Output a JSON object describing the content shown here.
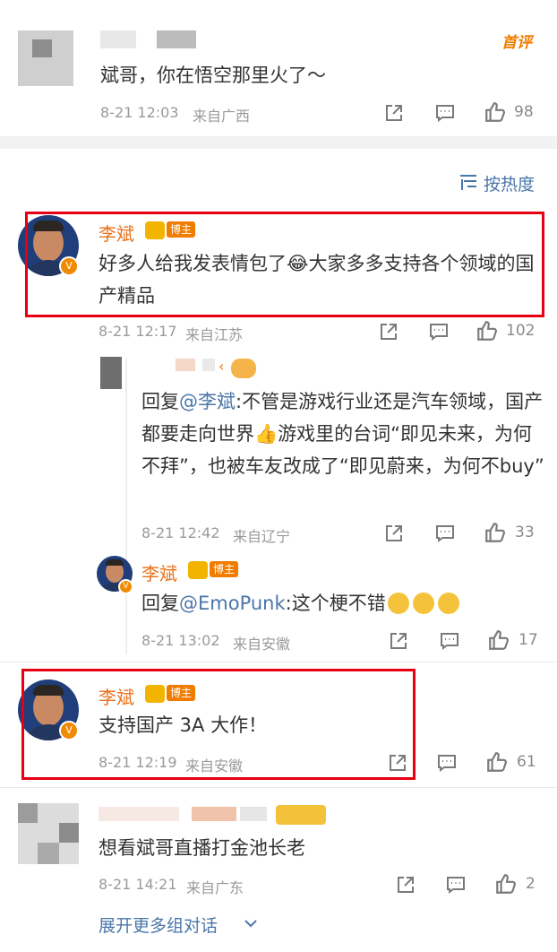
{
  "top_comment": {
    "text": "斌哥，你在悟空那里火了～",
    "time": "8-21 12:03",
    "location": "来自广西",
    "likes": "98",
    "first_badge": "首评"
  },
  "sort": {
    "label": "按热度"
  },
  "comment1": {
    "author": "李斌",
    "badge": "博主",
    "text": "好多人给我发表情包了😂大家多多支持各个领域的国产精品",
    "time": "8-21 12:17",
    "location": "来自江苏",
    "likes": "102"
  },
  "reply1": {
    "prefix": "回复",
    "mention": "@李斌",
    "text": ":不管是游戏行业还是汽车领域，国产都要走向世界👍游戏里的台词“即见未来，为何不拜”，也被车友改成了“即见蔚来，为何不buy”",
    "time": "8-21 12:42",
    "location": "来自辽宁",
    "likes": "33"
  },
  "reply2": {
    "author": "李斌",
    "badge": "博主",
    "prefix": "回复",
    "mention": "@EmoPunk",
    "text": ":这个梗不错",
    "time": "8-21 13:02",
    "location": "来自安徽",
    "likes": "17"
  },
  "comment2": {
    "author": "李斌",
    "badge": "博主",
    "text": "支持国产 3A 大作！",
    "time": "8-21 12:19",
    "location": "来自安徽",
    "likes": "61"
  },
  "comment3": {
    "text": "想看斌哥直播打金池长老",
    "time": "8-21 14:21",
    "location": "来自广东",
    "likes": "2"
  },
  "expand": {
    "label": "展开更多组对话"
  },
  "colors": {
    "name": "#e8711a",
    "link": "#4a76a8",
    "highlight": "#e60012"
  },
  "icons": [
    "share-icon",
    "comment-icon",
    "like-icon",
    "sort-icon",
    "chevron-down-icon",
    "crown-badge-icon"
  ]
}
